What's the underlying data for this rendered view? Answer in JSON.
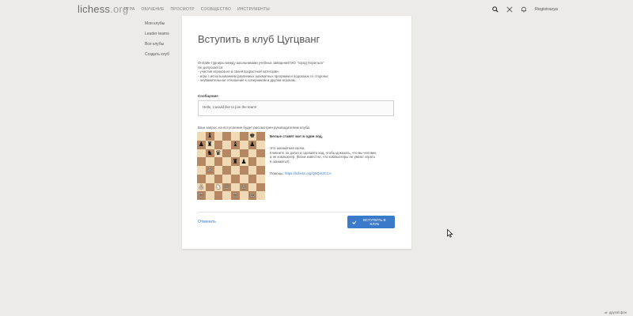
{
  "header": {
    "logo_main": "lichess",
    "logo_tld": ".org",
    "nav": [
      "Игра",
      "Обучение",
      "Просмотр",
      "Сообщество",
      "Инструменты"
    ],
    "signin": "Registrazya"
  },
  "sidebar": {
    "items": [
      "Мои клубы",
      "Leader teams",
      "Все клубы",
      "Создать клуб"
    ]
  },
  "main": {
    "title": "Вступить в клуб Цугцванг",
    "description": [
      "Онлайн-турниры между школьниками учебных заведений МО \"город Норильск\"",
      "Не допускается:",
      "- участие игроков не в своей возрастной категории;",
      "- игра с использованием различных шахматных программ и подсказок со стороны;",
      "- неуважительное отношение к соперникам и другим игрокам."
    ],
    "message_label": "Сообщение",
    "message_value": "Hello, I would like to join the team!",
    "notify_text": "Ваш запрос на вступление будет рассмотрен руководителем клуба.",
    "puzzle_title": "Белые ставят мат в один ход.",
    "puzzle_text": [
      "Это шахматная капча.",
      "Кликните по доске и сделайте ход, чтобы доказать, что вы человек,",
      "а не компьютер. (Всем известно, что компьютеры не умеют играть",
      "в шахматы!)."
    ],
    "help_label": "Помощь:",
    "help_link": "https://lichess.org/Q5Qm3CCA",
    "cancel_label": "Отменить",
    "submit_label": "Вступить в клуб"
  },
  "board": [
    [
      "",
      "b:♝",
      "",
      "",
      "",
      "",
      "b:♚",
      ""
    ],
    [
      "b:♟",
      "b:♜",
      "",
      "",
      "b:♝",
      "",
      "b:♟",
      ""
    ],
    [
      "",
      "b:♞",
      "b:♛",
      "",
      "",
      "",
      "",
      ""
    ],
    [
      "",
      "",
      "",
      "",
      "b:♜",
      "b:♟",
      "",
      ""
    ],
    [
      "",
      "w:♙",
      "",
      "",
      "",
      "",
      "",
      ""
    ],
    [
      "",
      "",
      "",
      "",
      "",
      "",
      "",
      ""
    ],
    [
      "w:♙",
      "",
      "w:♞",
      "w:♕",
      "",
      "w:♙",
      "",
      ""
    ],
    [
      "w:♖",
      "",
      "",
      "",
      "w:♖",
      "",
      "w:♔",
      ""
    ]
  ],
  "footer": {
    "label": "другой фон"
  },
  "colors": {
    "accent": "#3b79c9",
    "link": "#3b7bbf",
    "light_square": "#f0d9b5",
    "dark_square": "#b58863"
  }
}
